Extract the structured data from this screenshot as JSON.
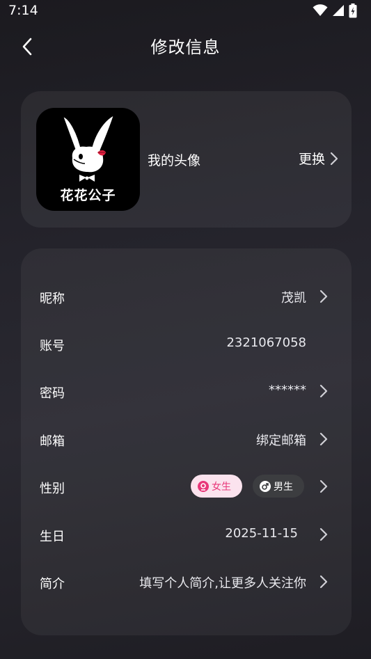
{
  "status_bar": {
    "time": "7:14"
  },
  "header": {
    "title": "修改信息"
  },
  "avatar": {
    "label": "我的头像",
    "change_label": "更换",
    "logo_text": "花花公子"
  },
  "profile": {
    "nickname": {
      "label": "昵称",
      "value": "茂凯"
    },
    "account": {
      "label": "账号",
      "value": "2321067058"
    },
    "password": {
      "label": "密码",
      "value": "******"
    },
    "email": {
      "label": "邮箱",
      "value": "绑定邮箱"
    },
    "gender": {
      "label": "性别",
      "female": "女生",
      "male": "男生",
      "selected": "女生"
    },
    "birthday": {
      "label": "生日",
      "value": "2025-11-15"
    },
    "bio": {
      "label": "简介",
      "value": "填写个人简介,让更多人关注你"
    }
  },
  "colors": {
    "female_accent": "#e8387a",
    "female_bg": "#fbe3ee",
    "male_bg": "#3c3d40"
  }
}
